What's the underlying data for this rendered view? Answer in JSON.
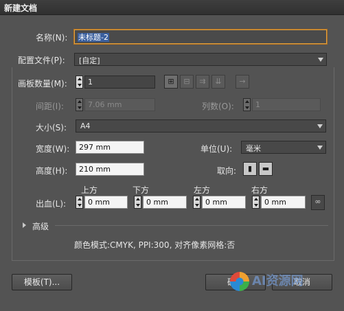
{
  "window": {
    "title": "新建文档"
  },
  "name": {
    "label": "名称(N):",
    "value": "未标题-2"
  },
  "profile": {
    "label": "配置文件(P):",
    "value": "[自定]"
  },
  "artboards": {
    "count_label": "画板数量(M):",
    "count_value": "1",
    "spacing_label": "间距(I):",
    "spacing_value": "7.06 mm",
    "columns_label": "列数(O):",
    "columns_value": "1"
  },
  "size": {
    "label": "大小(S):",
    "value": "A4"
  },
  "width": {
    "label": "宽度(W):",
    "value": "297 mm"
  },
  "height": {
    "label": "高度(H):",
    "value": "210 mm"
  },
  "units": {
    "label": "单位(U):",
    "value": "毫米"
  },
  "orientation": {
    "label": "取向:"
  },
  "bleed": {
    "label": "出血(L):",
    "top_label": "上方",
    "top_value": "0 mm",
    "bottom_label": "下方",
    "bottom_value": "0 mm",
    "left_label": "左方",
    "left_value": "0 mm",
    "right_label": "右方",
    "right_value": "0 mm"
  },
  "advanced": {
    "label": "高级"
  },
  "info": {
    "text": "颜色模式:CMYK, PPI:300, 对齐像素网格:否"
  },
  "buttons": {
    "templates": "模板(T)...",
    "ok": "确定",
    "cancel": "取消"
  },
  "watermark": {
    "text": "AI资源网"
  }
}
